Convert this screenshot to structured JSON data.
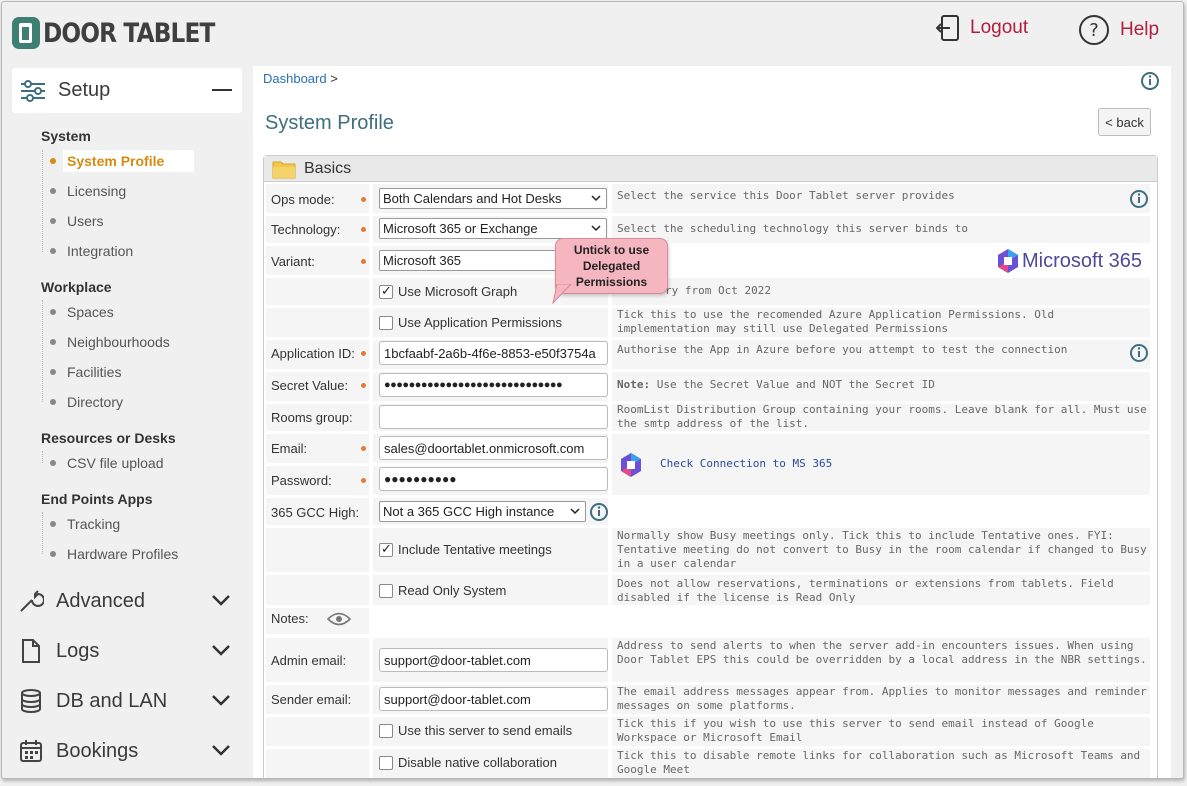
{
  "header": {
    "logo_text": "DOOR TABLET",
    "logout_label": "Logout",
    "help_label": "Help"
  },
  "sidebar": {
    "setup_label": "Setup",
    "groups": [
      {
        "title": "System",
        "items": [
          "System Profile",
          "Licensing",
          "Users",
          "Integration"
        ]
      },
      {
        "title": "Workplace",
        "items": [
          "Spaces",
          "Neighbourhoods",
          "Facilities",
          "Directory"
        ]
      },
      {
        "title": "Resources or Desks",
        "items": [
          "CSV file upload"
        ]
      },
      {
        "title": "End Points Apps",
        "items": [
          "Tracking",
          "Hardware Profiles"
        ]
      }
    ],
    "active_item": "System Profile",
    "sections": [
      "Advanced",
      "Logs",
      "DB and LAN",
      "Bookings"
    ]
  },
  "main": {
    "breadcrumb": "Dashboard",
    "breadcrumb_sep": ">",
    "title": "System Profile",
    "back_label": "< back",
    "panel_title": "Basics",
    "callout": "Untick to use Delegated Permissions",
    "ms365_label": "Microsoft 365",
    "check_connection": "Check Connection to MS 365",
    "fields": {
      "ops_mode": {
        "label": "Ops mode:",
        "value": "Both Calendars and Hot Desks",
        "desc": "Select the service this Door Tablet server provides"
      },
      "technology": {
        "label": "Technology:",
        "value": "Microsoft 365 or Exchange",
        "desc": "Select the scheduling technology this server binds to"
      },
      "variant": {
        "label": "Variant:",
        "value": "Microsoft 365"
      },
      "use_graph": {
        "label": "Use Microsoft Graph",
        "checked": true,
        "desc": "ry from Oct 2022"
      },
      "use_app_perm": {
        "label": "Use Application Permissions",
        "checked": false,
        "desc": "Tick this to use the recomended Azure Application Permissions. Old implementation may still use Delegated Permissions"
      },
      "app_id": {
        "label": "Application ID:",
        "value": "1bcfaabf-2a6b-4f6e-8853-e50f3754a",
        "desc": "Authorise the App in Azure before you attempt to test the connection"
      },
      "secret": {
        "label": "Secret Value:",
        "value": "●●●●●●●●●●●●●●●●●●●●●●●●●●●●●",
        "desc_bold": "Note:",
        "desc": " Use the Secret Value and NOT the Secret ID"
      },
      "rooms_group": {
        "label": "Rooms group:",
        "value": "",
        "desc": "RoomList Distribution Group containing your rooms. Leave blank for all.  Must use the smtp address of the list."
      },
      "email": {
        "label": "Email:",
        "value": "sales@doortablet.onmicrosoft.com"
      },
      "password": {
        "label": "Password:",
        "value": "●●●●●●●●●●"
      },
      "gcc_high": {
        "label": "365 GCC High:",
        "value": "Not a 365 GCC High instance"
      },
      "tentative": {
        "label": "Include Tentative meetings",
        "checked": true,
        "desc": "Normally show Busy meetings only. Tick this to include Tentative ones. FYI: Tentative meeting do not convert to Busy in the room calendar if changed to Busy in a user calendar"
      },
      "read_only": {
        "label": "Read Only System",
        "checked": false,
        "desc": "Does not allow reservations, terminations or extensions from tablets. Field disabled if the license is Read Only"
      },
      "notes": {
        "label": "Notes:"
      },
      "admin_email": {
        "label": "Admin email:",
        "value": "support@door-tablet.com",
        "desc": "Address to send alerts to when the server add-in encounters issues.  When using Door Tablet EPS this could be overridden by a local address in the NBR settings."
      },
      "sender_email": {
        "label": "Sender email:",
        "value": "support@door-tablet.com",
        "desc": "The email address messages appear from. Applies to monitor messages and reminder messages on some platforms."
      },
      "send_emails": {
        "label": "Use this server to send emails",
        "checked": false,
        "desc": "Tick this if you wish to use this server to send email instead of Google Workspace or Microsoft Email"
      },
      "disable_collab": {
        "label": "Disable native collaboration",
        "checked": false,
        "desc": "Tick this to disable remote links for collaboration such as Microsoft Teams and Google Meet"
      }
    }
  },
  "colors": {
    "accent": "#b01e3c",
    "active": "#d68a12",
    "title": "#3e6e80",
    "link": "#2a6fb3",
    "required_dot": "#e07b39",
    "callout_bg": "#f6b6c0"
  }
}
